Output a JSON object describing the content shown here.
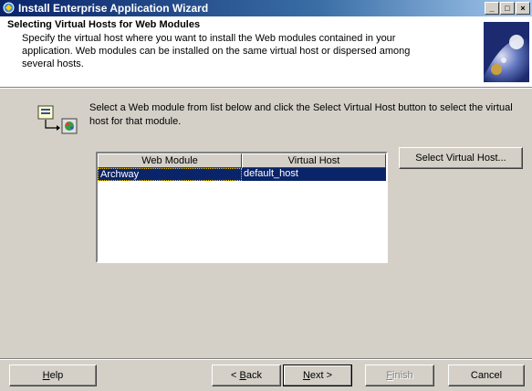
{
  "window": {
    "title": "Install Enterprise Application Wizard",
    "controls": {
      "minimize": "_",
      "maximize": "□",
      "close": "×"
    }
  },
  "header": {
    "title": "Selecting Virtual Hosts for Web Modules",
    "description": "Specify the virtual host where you want to install the Web modules contained in your application. Web modules can be installed on the same virtual host or dispersed among several hosts."
  },
  "body": {
    "instruction": "Select a Web module from list below and click the Select Virtual Host button to select the virtual host for that module."
  },
  "table": {
    "columns": [
      "Web Module",
      "Virtual Host"
    ],
    "rows": [
      {
        "web_module": "Archway",
        "virtual_host": "default_host",
        "selected": true
      }
    ]
  },
  "buttons": {
    "select_virtual_host": "Select Virtual Host...",
    "help": {
      "mnemonic": "H",
      "rest": "elp"
    },
    "back": {
      "prefix": "< ",
      "mnemonic": "B",
      "rest": "ack"
    },
    "next": {
      "mnemonic": "N",
      "rest": "ext >"
    },
    "finish": {
      "mnemonic": "F",
      "rest": "inish"
    },
    "cancel": "Cancel"
  },
  "colors": {
    "selection": "#0a246a",
    "face": "#d4d0c8",
    "title_start": "#0a246a",
    "title_end": "#a6caf0"
  }
}
